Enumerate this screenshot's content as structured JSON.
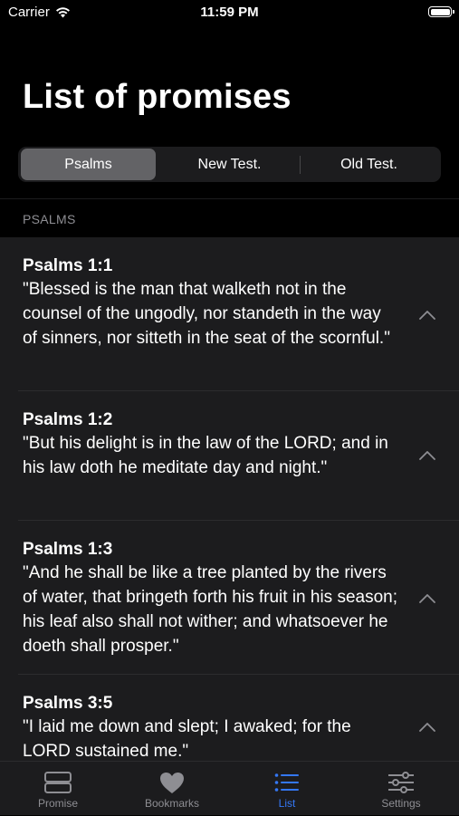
{
  "status_bar": {
    "carrier": "Carrier",
    "time": "11:59 PM"
  },
  "header": {
    "title": "List of promises"
  },
  "segmented_control": {
    "segments": [
      "Psalms",
      "New Test.",
      "Old Test."
    ],
    "selected": "Psalms"
  },
  "section": {
    "header": "PSALMS"
  },
  "promises": [
    {
      "reference": "Psalms 1:1",
      "text": "\"Blessed is the man that walketh not in the counsel of the ungodly, nor standeth in the way of sinners, nor sitteth in the seat of the scornful.\""
    },
    {
      "reference": "Psalms 1:2",
      "text": "\"But his delight is in the law of the LORD; and in his law doth he meditate day and night.\""
    },
    {
      "reference": "Psalms 1:3",
      "text": "\"And he shall be like a tree planted by the rivers of water, that bringeth forth his fruit in his season; his leaf also shall not wither; and whatsoever he doeth shall prosper.\""
    },
    {
      "reference": "Psalms 3:5",
      "text": "\"I laid me down and slept; I awaked; for the LORD sustained me.\""
    }
  ],
  "tab_bar": {
    "tabs": [
      {
        "label": "Promise",
        "icon": "promise-icon"
      },
      {
        "label": "Bookmarks",
        "icon": "heart-icon"
      },
      {
        "label": "List",
        "icon": "list-icon"
      },
      {
        "label": "Settings",
        "icon": "sliders-icon"
      }
    ],
    "active": "List"
  },
  "colors": {
    "background": "#000000",
    "cell_background": "#1c1c1e",
    "accent": "#3478f6",
    "secondary_text": "#8e8e93",
    "segment_selected": "#636366"
  }
}
